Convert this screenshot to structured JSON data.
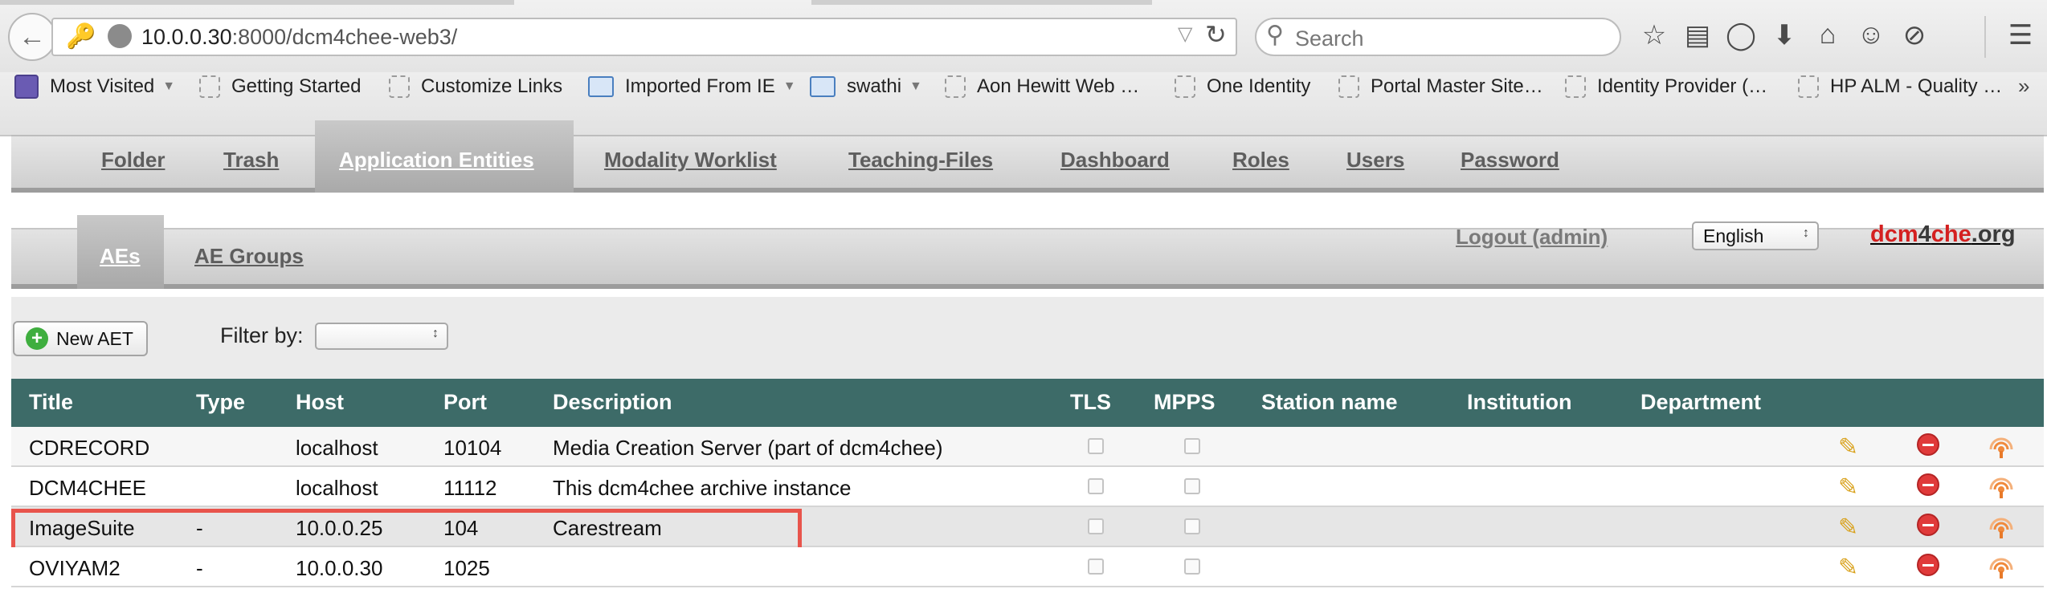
{
  "browser": {
    "url_host": "10.0.0.30",
    "url_rest": ":8000/dcm4chee-web3/",
    "search_placeholder": "Search"
  },
  "bookmarks": [
    {
      "label": "Most Visited",
      "icon": "most-visited-icon",
      "dropdown": true
    },
    {
      "label": "Getting Started",
      "icon": "page-icon"
    },
    {
      "label": "Customize Links",
      "icon": "page-icon"
    },
    {
      "label": "Imported From IE",
      "icon": "folder-icon",
      "dropdown": true
    },
    {
      "label": "swathi",
      "icon": "folder-icon",
      "dropdown": true
    },
    {
      "label": "Aon Hewitt Web …",
      "icon": "page-icon"
    },
    {
      "label": "One Identity",
      "icon": "page-icon"
    },
    {
      "label": "Portal Master Site…",
      "icon": "page-icon"
    },
    {
      "label": "Identity Provider (…",
      "icon": "page-icon"
    },
    {
      "label": "HP ALM - Quality …",
      "icon": "page-icon"
    }
  ],
  "nav": {
    "main_tabs": [
      "Folder",
      "Trash",
      "Application Entities",
      "Modality Worklist",
      "Teaching-Files",
      "Dashboard",
      "Roles",
      "Users",
      "Password"
    ],
    "active_main": "Application Entities",
    "sub_tabs": [
      "AEs",
      "AE Groups"
    ],
    "active_sub": "AEs",
    "logout": "Logout (admin)",
    "language": "English",
    "brand_red1": "dcm",
    "brand_dark1": "4",
    "brand_red2": "che",
    "brand_dark2": ".org"
  },
  "toolbar": {
    "new_aet_label": "New AET",
    "filter_label": "Filter by:",
    "filter_value": ""
  },
  "table": {
    "headers": [
      "Title",
      "Type",
      "Host",
      "Port",
      "Description",
      "TLS",
      "MPPS",
      "Station name",
      "Institution",
      "Department"
    ],
    "rows": [
      {
        "title": "CDRECORD",
        "type": "",
        "host": "localhost",
        "port": "10104",
        "description": "Media Creation Server (part of dcm4chee)",
        "tls": false,
        "mpps": false,
        "station": "",
        "institution": "",
        "department": ""
      },
      {
        "title": "DCM4CHEE",
        "type": "",
        "host": "localhost",
        "port": "11112",
        "description": "This dcm4chee archive instance",
        "tls": false,
        "mpps": false,
        "station": "",
        "institution": "",
        "department": ""
      },
      {
        "title": "ImageSuite",
        "type": "-",
        "host": "10.0.0.25",
        "port": "104",
        "description": "Carestream",
        "tls": false,
        "mpps": false,
        "station": "",
        "institution": "",
        "department": "",
        "highlighted": true
      },
      {
        "title": "OVIYAM2",
        "type": "-",
        "host": "10.0.0.30",
        "port": "1025",
        "description": "",
        "tls": false,
        "mpps": false,
        "station": "",
        "institution": "",
        "department": ""
      }
    ]
  },
  "colors": {
    "table_header": "#3d6b68",
    "highlight_box": "#e8544c",
    "brand_red": "#d42020"
  }
}
